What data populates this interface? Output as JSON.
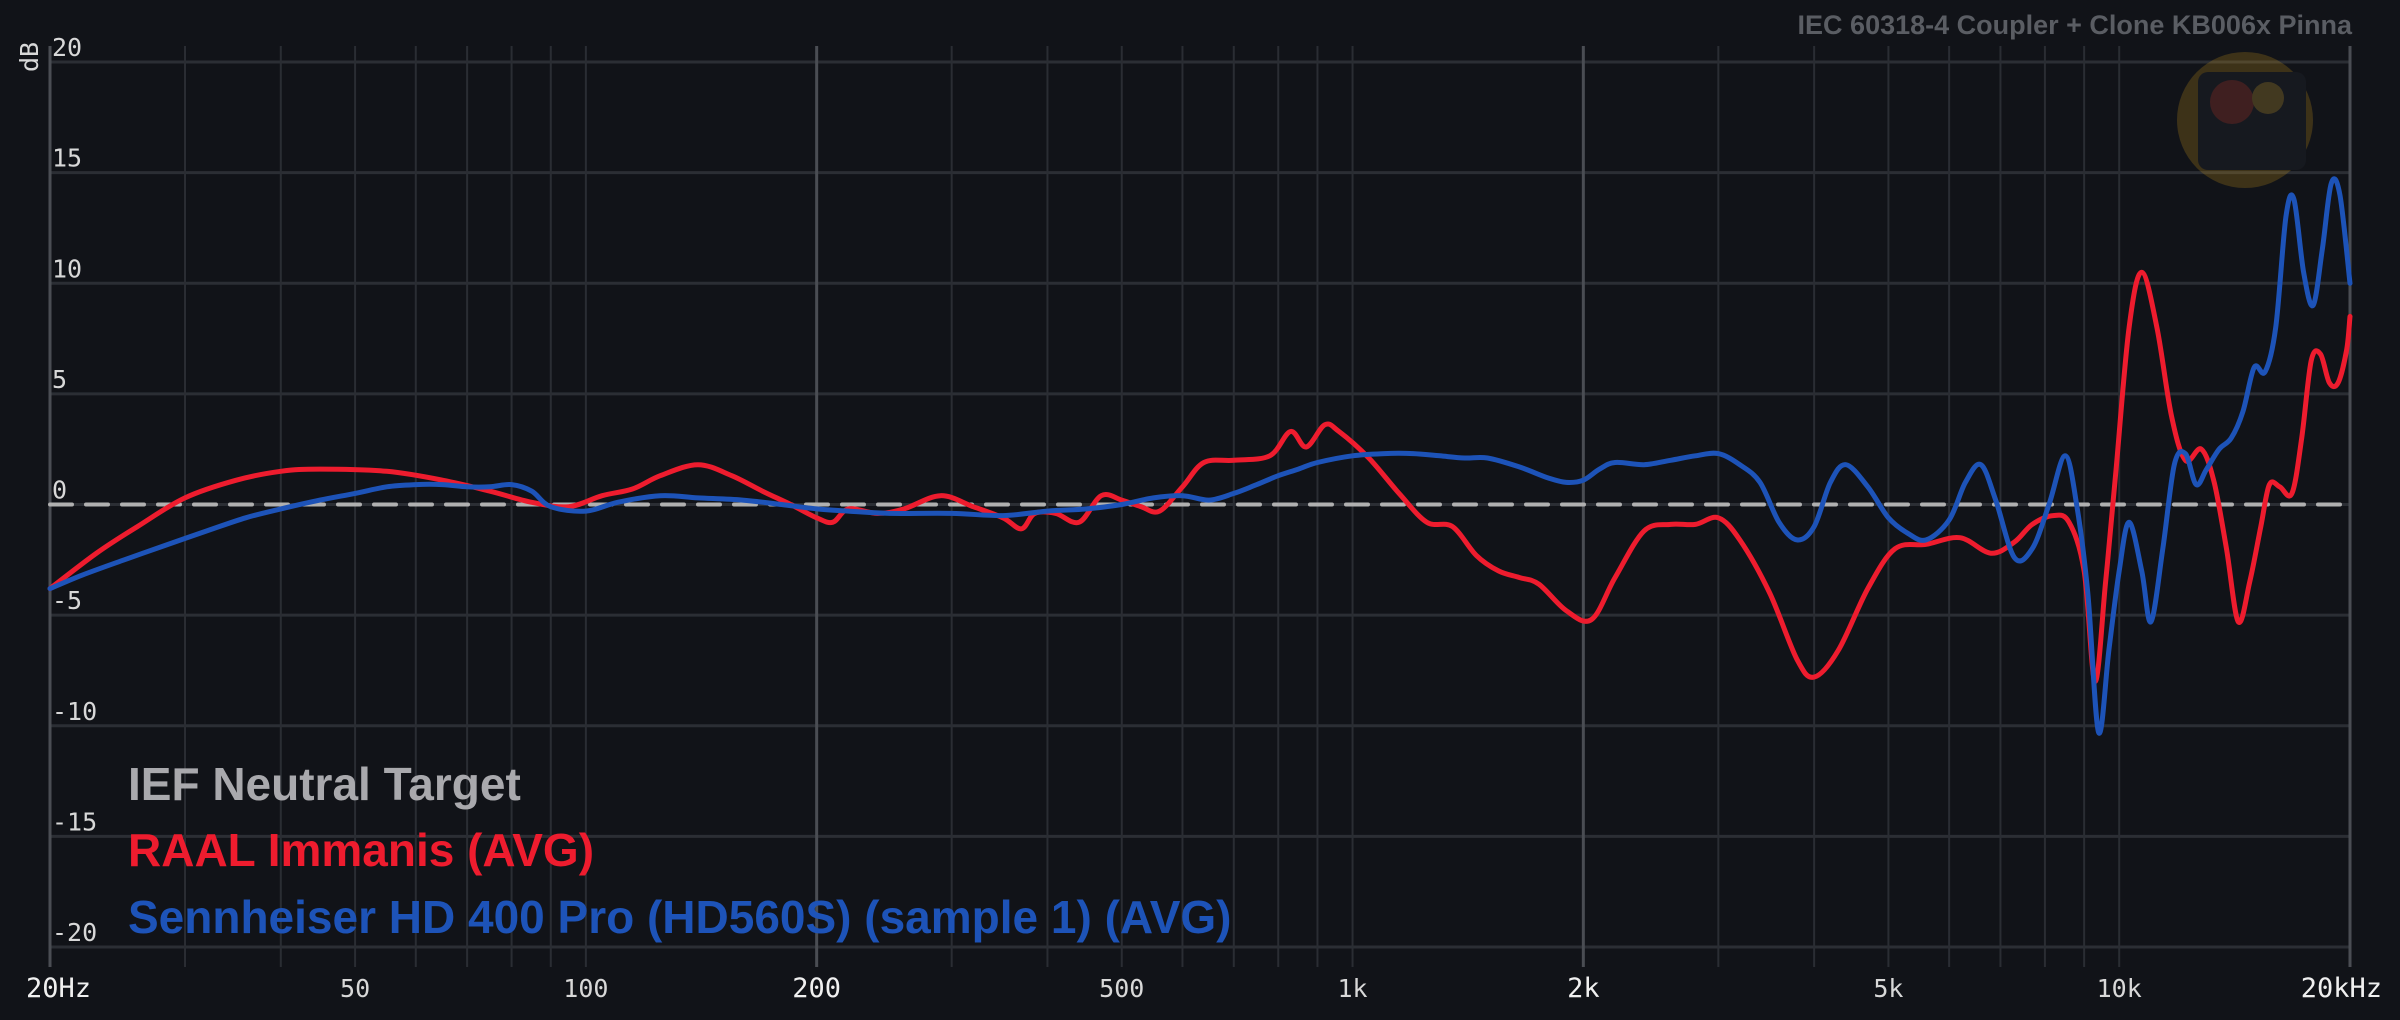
{
  "header": {
    "rig_label": "IEC 60318-4 Coupler + Clone KB006x Pinna"
  },
  "watermark": {
    "icon": "avatar-logo-icon"
  },
  "chart_data": {
    "type": "line",
    "title": "",
    "xlabel": "",
    "ylabel": "dB",
    "x_scale": "log",
    "xlim": [
      20,
      20000
    ],
    "ylim": [
      -20,
      21
    ],
    "grid": true,
    "legend_position": "bottom-left",
    "y_ticks": [
      "20",
      "15",
      "10",
      "5",
      "0",
      "-5",
      "-10",
      "-15",
      "-20"
    ],
    "x_ticks": [
      {
        "label": "20Hz",
        "value": 20,
        "major": true
      },
      {
        "label": "50",
        "value": 50,
        "major": false
      },
      {
        "label": "100",
        "value": 100,
        "major": false
      },
      {
        "label": "200",
        "value": 200,
        "major": true
      },
      {
        "label": "500",
        "value": 500,
        "major": false
      },
      {
        "label": "1k",
        "value": 1000,
        "major": false
      },
      {
        "label": "2k",
        "value": 2000,
        "major": true
      },
      {
        "label": "5k",
        "value": 5000,
        "major": false
      },
      {
        "label": "10k",
        "value": 10000,
        "major": false
      },
      {
        "label": "20kHz",
        "value": 20000,
        "major": true
      }
    ],
    "series": [
      {
        "name": "IEF Neutral Target",
        "color": "#b0b0b0",
        "style": "dashed",
        "points": [
          [
            20,
            0
          ],
          [
            20000,
            0
          ]
        ]
      },
      {
        "name": "RAAL Immanis (AVG)",
        "color": "#ee1c2e",
        "style": "solid",
        "points": [
          [
            20,
            -3.8
          ],
          [
            23,
            -2.2
          ],
          [
            26,
            -1.0
          ],
          [
            30,
            0.3
          ],
          [
            35,
            1.1
          ],
          [
            40,
            1.5
          ],
          [
            45,
            1.6
          ],
          [
            55,
            1.5
          ],
          [
            65,
            1.1
          ],
          [
            75,
            0.6
          ],
          [
            85,
            0.1
          ],
          [
            95,
            -0.1
          ],
          [
            105,
            0.4
          ],
          [
            115,
            0.7
          ],
          [
            125,
            1.3
          ],
          [
            140,
            1.8
          ],
          [
            155,
            1.3
          ],
          [
            170,
            0.6
          ],
          [
            185,
            0.0
          ],
          [
            200,
            -0.6
          ],
          [
            210,
            -0.8
          ],
          [
            220,
            -0.2
          ],
          [
            240,
            -0.4
          ],
          [
            260,
            -0.2
          ],
          [
            290,
            0.4
          ],
          [
            320,
            -0.1
          ],
          [
            350,
            -0.6
          ],
          [
            370,
            -1.1
          ],
          [
            385,
            -0.4
          ],
          [
            410,
            -0.4
          ],
          [
            440,
            -0.8
          ],
          [
            470,
            0.4
          ],
          [
            500,
            0.2
          ],
          [
            530,
            -0.1
          ],
          [
            560,
            -0.3
          ],
          [
            600,
            0.8
          ],
          [
            640,
            1.9
          ],
          [
            700,
            2.0
          ],
          [
            780,
            2.2
          ],
          [
            830,
            3.3
          ],
          [
            870,
            2.6
          ],
          [
            920,
            3.6
          ],
          [
            960,
            3.3
          ],
          [
            1050,
            2.1
          ],
          [
            1150,
            0.5
          ],
          [
            1250,
            -0.8
          ],
          [
            1350,
            -1.0
          ],
          [
            1450,
            -2.3
          ],
          [
            1550,
            -3.0
          ],
          [
            1650,
            -3.3
          ],
          [
            1750,
            -3.6
          ],
          [
            1900,
            -4.8
          ],
          [
            2050,
            -5.2
          ],
          [
            2200,
            -3.3
          ],
          [
            2400,
            -1.2
          ],
          [
            2600,
            -0.9
          ],
          [
            2800,
            -0.9
          ],
          [
            3000,
            -0.6
          ],
          [
            3200,
            -1.6
          ],
          [
            3500,
            -4.0
          ],
          [
            3800,
            -7.0
          ],
          [
            4000,
            -7.8
          ],
          [
            4300,
            -6.6
          ],
          [
            4700,
            -3.8
          ],
          [
            5100,
            -2.0
          ],
          [
            5600,
            -1.8
          ],
          [
            6200,
            -1.5
          ],
          [
            6800,
            -2.2
          ],
          [
            7300,
            -1.7
          ],
          [
            7700,
            -0.9
          ],
          [
            8200,
            -0.5
          ],
          [
            8600,
            -0.8
          ],
          [
            9000,
            -3.0
          ],
          [
            9300,
            -8.0
          ],
          [
            9600,
            -3.5
          ],
          [
            9900,
            1.5
          ],
          [
            10300,
            8.0
          ],
          [
            10700,
            10.5
          ],
          [
            11200,
            8.0
          ],
          [
            11700,
            4.0
          ],
          [
            12200,
            2.0
          ],
          [
            12800,
            2.5
          ],
          [
            13300,
            1.0
          ],
          [
            13800,
            -2.0
          ],
          [
            14300,
            -5.3
          ],
          [
            14800,
            -3.5
          ],
          [
            15300,
            -1.0
          ],
          [
            15700,
            0.9
          ],
          [
            16200,
            0.8
          ],
          [
            16800,
            0.5
          ],
          [
            17300,
            3.0
          ],
          [
            17800,
            6.5
          ],
          [
            18300,
            6.8
          ],
          [
            18800,
            5.5
          ],
          [
            19300,
            5.5
          ],
          [
            19800,
            7.0
          ],
          [
            20000,
            8.5
          ]
        ]
      },
      {
        "name": "Sennheiser HD 400 Pro (HD560S) (sample 1) (AVG)",
        "color": "#1d53b8",
        "style": "solid",
        "points": [
          [
            20,
            -3.8
          ],
          [
            22,
            -3.2
          ],
          [
            25,
            -2.5
          ],
          [
            28,
            -1.9
          ],
          [
            32,
            -1.2
          ],
          [
            36,
            -0.6
          ],
          [
            40,
            -0.2
          ],
          [
            45,
            0.2
          ],
          [
            50,
            0.5
          ],
          [
            55,
            0.8
          ],
          [
            60,
            0.9
          ],
          [
            65,
            0.9
          ],
          [
            70,
            0.8
          ],
          [
            75,
            0.8
          ],
          [
            80,
            0.9
          ],
          [
            85,
            0.6
          ],
          [
            90,
            -0.1
          ],
          [
            100,
            -0.3
          ],
          [
            110,
            0.1
          ],
          [
            125,
            0.4
          ],
          [
            140,
            0.3
          ],
          [
            160,
            0.2
          ],
          [
            180,
            0.0
          ],
          [
            200,
            -0.2
          ],
          [
            220,
            -0.3
          ],
          [
            250,
            -0.4
          ],
          [
            300,
            -0.4
          ],
          [
            350,
            -0.5
          ],
          [
            400,
            -0.3
          ],
          [
            450,
            -0.2
          ],
          [
            500,
            0.0
          ],
          [
            550,
            0.3
          ],
          [
            600,
            0.4
          ],
          [
            650,
            0.2
          ],
          [
            700,
            0.5
          ],
          [
            750,
            0.9
          ],
          [
            800,
            1.3
          ],
          [
            850,
            1.6
          ],
          [
            900,
            1.9
          ],
          [
            1000,
            2.2
          ],
          [
            1100,
            2.3
          ],
          [
            1200,
            2.3
          ],
          [
            1300,
            2.2
          ],
          [
            1400,
            2.1
          ],
          [
            1500,
            2.1
          ],
          [
            1650,
            1.7
          ],
          [
            1800,
            1.2
          ],
          [
            1900,
            1.0
          ],
          [
            2000,
            1.1
          ],
          [
            2100,
            1.6
          ],
          [
            2200,
            1.9
          ],
          [
            2400,
            1.8
          ],
          [
            2600,
            2.0
          ],
          [
            2800,
            2.2
          ],
          [
            3000,
            2.3
          ],
          [
            3200,
            1.8
          ],
          [
            3400,
            1.0
          ],
          [
            3600,
            -0.8
          ],
          [
            3800,
            -1.6
          ],
          [
            4000,
            -1.0
          ],
          [
            4200,
            1.0
          ],
          [
            4400,
            1.8
          ],
          [
            4700,
            0.8
          ],
          [
            5000,
            -0.6
          ],
          [
            5300,
            -1.3
          ],
          [
            5600,
            -1.6
          ],
          [
            6000,
            -0.7
          ],
          [
            6300,
            1.0
          ],
          [
            6600,
            1.8
          ],
          [
            6900,
            0.2
          ],
          [
            7300,
            -2.4
          ],
          [
            7700,
            -2.0
          ],
          [
            8100,
            0.0
          ],
          [
            8500,
            2.2
          ],
          [
            8800,
            0.0
          ],
          [
            9100,
            -4.0
          ],
          [
            9400,
            -10.3
          ],
          [
            9700,
            -6.5
          ],
          [
            10000,
            -3.0
          ],
          [
            10300,
            -0.8
          ],
          [
            10700,
            -3.0
          ],
          [
            11000,
            -5.3
          ],
          [
            11400,
            -2.0
          ],
          [
            11800,
            1.8
          ],
          [
            12200,
            2.3
          ],
          [
            12600,
            0.9
          ],
          [
            13000,
            1.6
          ],
          [
            13500,
            2.5
          ],
          [
            14000,
            3.0
          ],
          [
            14500,
            4.2
          ],
          [
            15000,
            6.2
          ],
          [
            15500,
            6.0
          ],
          [
            16000,
            8.0
          ],
          [
            16500,
            13.0
          ],
          [
            16900,
            13.8
          ],
          [
            17400,
            10.5
          ],
          [
            17900,
            9.0
          ],
          [
            18400,
            11.5
          ],
          [
            18900,
            14.5
          ],
          [
            19400,
            14.0
          ],
          [
            20000,
            10.0
          ]
        ]
      }
    ]
  }
}
